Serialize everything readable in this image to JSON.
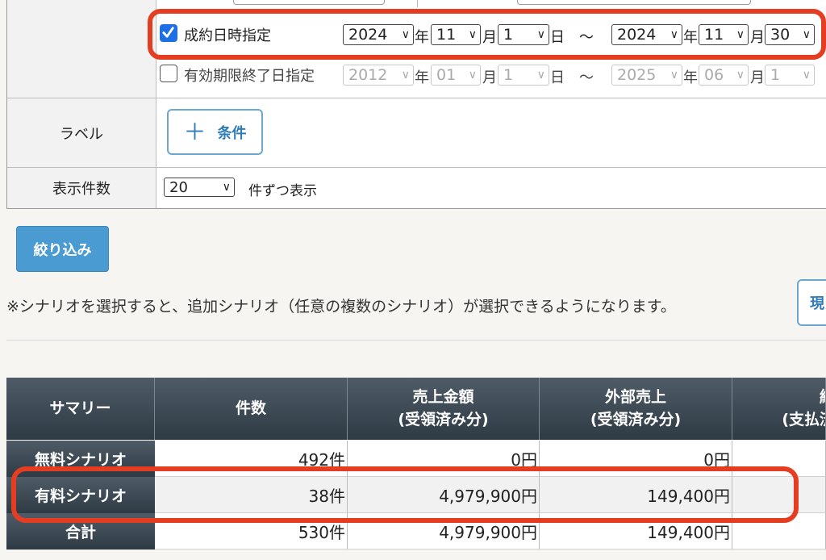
{
  "filters": {
    "contract_date": {
      "label": "成約日時指定",
      "checked": true,
      "from": {
        "year": "2024",
        "month": "11",
        "day": "1"
      },
      "to": {
        "year": "2024",
        "month": "11",
        "day": "30"
      }
    },
    "expiry_date": {
      "label": "有効期限終了日指定",
      "checked": false,
      "from": {
        "year": "2012",
        "month": "01",
        "day": "1"
      },
      "to": {
        "year": "2025",
        "month": "06",
        "day": "1"
      }
    },
    "units": {
      "year": "年",
      "month": "月",
      "day": "日",
      "tilde": "～"
    },
    "label_row": {
      "label": "ラベル",
      "button": "条件"
    },
    "count_row": {
      "label": "表示件数",
      "value": "20",
      "suffix": "件ずつ表示"
    }
  },
  "filter_button": "絞り込み",
  "note": "※シナリオを選択すると、追加シナリオ（任意の複数のシナリオ）が選択できるようになります。",
  "side_button": "現",
  "summary": {
    "headers": [
      {
        "l1": "サマリー",
        "l2": ""
      },
      {
        "l1": "件数",
        "l2": ""
      },
      {
        "l1": "売上金額",
        "l2": "(受領済み分)"
      },
      {
        "l1": "外部売上",
        "l2": "(受領済み分)"
      },
      {
        "l1": "経",
        "l2": "(支払済"
      }
    ],
    "rows": [
      {
        "name": "無料シナリオ",
        "count": "492件",
        "sales": "0円",
        "external": "0円"
      },
      {
        "name": "有料シナリオ",
        "count": "38件",
        "sales": "4,979,900円",
        "external": "149,400円"
      },
      {
        "name": "合計",
        "count": "530件",
        "sales": "4,979,900円",
        "external": "149,400円"
      }
    ]
  },
  "colors": {
    "accent": "#4a9bd2",
    "highlight": "#e53d21",
    "header_dark": "#2e3a44"
  }
}
